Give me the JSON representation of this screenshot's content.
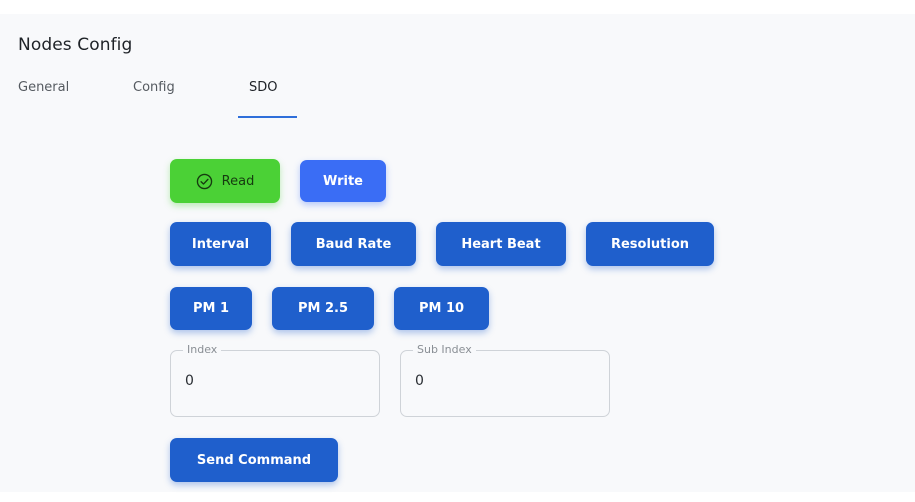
{
  "header": {
    "title": "Nodes Config"
  },
  "tabs": [
    {
      "label": "General",
      "active": false
    },
    {
      "label": "Config",
      "active": false
    },
    {
      "label": "SDO",
      "active": true
    }
  ],
  "mode": {
    "read_label": "Read",
    "write_label": "Write",
    "selected": "Read"
  },
  "parameters": [
    {
      "label": "Interval"
    },
    {
      "label": "Baud Rate"
    },
    {
      "label": "Heart Beat"
    },
    {
      "label": "Resolution"
    }
  ],
  "pm": [
    {
      "label": "PM 1"
    },
    {
      "label": "PM 2.5"
    },
    {
      "label": "PM 10"
    }
  ],
  "fields": {
    "index": {
      "label": "Index",
      "value": "0"
    },
    "sub_index": {
      "label": "Sub Index",
      "value": "0"
    }
  },
  "actions": {
    "send_label": "Send Command"
  },
  "colors": {
    "primary": "#1f5fcc",
    "write": "#3a6df5",
    "read_active": "#4bd136",
    "tab_indicator": "#2f6fda"
  },
  "icons": {
    "read": "check-circle-icon"
  }
}
